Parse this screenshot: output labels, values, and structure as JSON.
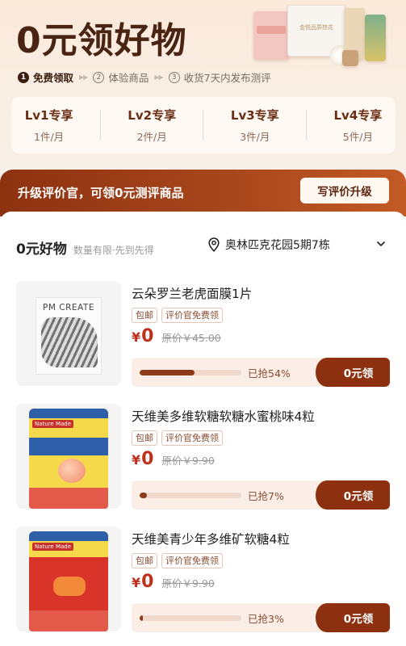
{
  "hero": {
    "title": "0元领好物",
    "steps": [
      {
        "num": "1",
        "label": "免费领取"
      },
      {
        "num": "2",
        "label": "体验商品"
      },
      {
        "num": "3",
        "label": "收货7天内发布测评"
      }
    ],
    "art_box_text": "金悦品质桂花"
  },
  "levels": [
    {
      "name": "Lv1专享",
      "quota": "1件/月"
    },
    {
      "name": "Lv2专享",
      "quota": "2件/月"
    },
    {
      "name": "Lv3专享",
      "quota": "3件/月"
    },
    {
      "name": "Lv4专享",
      "quota": "5件/月"
    }
  ],
  "promo": {
    "text": "升级评价官，可领0元测评商品",
    "button": "写评价升级"
  },
  "section": {
    "title": "0元好物",
    "subtitle": "数量有限·先到先得",
    "location": "奥林匹克花园5期7栋"
  },
  "products": [
    {
      "name": "云朵罗兰老虎面膜1片",
      "tags": [
        "包邮",
        "评价官免费领"
      ],
      "currency": "¥",
      "price": "0",
      "original": "原价￥45.00",
      "progress": 54,
      "grabbed": "已抢54%",
      "claim": "0元领",
      "pack_text": "PM CREATE"
    },
    {
      "name": "天维美多维软糖软糖水蜜桃味4粒",
      "tags": [
        "包邮",
        "评价官免费领"
      ],
      "currency": "¥",
      "price": "0",
      "original": "原价￥9.90",
      "progress": 7,
      "grabbed": "已抢7%",
      "claim": "0元领",
      "pack_text": "Nature Made"
    },
    {
      "name": "天维美青少年多维矿软糖4粒",
      "tags": [
        "包邮",
        "评价官免费领"
      ],
      "currency": "¥",
      "price": "0",
      "original": "原价￥9.90",
      "progress": 3,
      "grabbed": "已抢3%",
      "claim": "0元领",
      "pack_text": "Nature Made"
    }
  ]
}
